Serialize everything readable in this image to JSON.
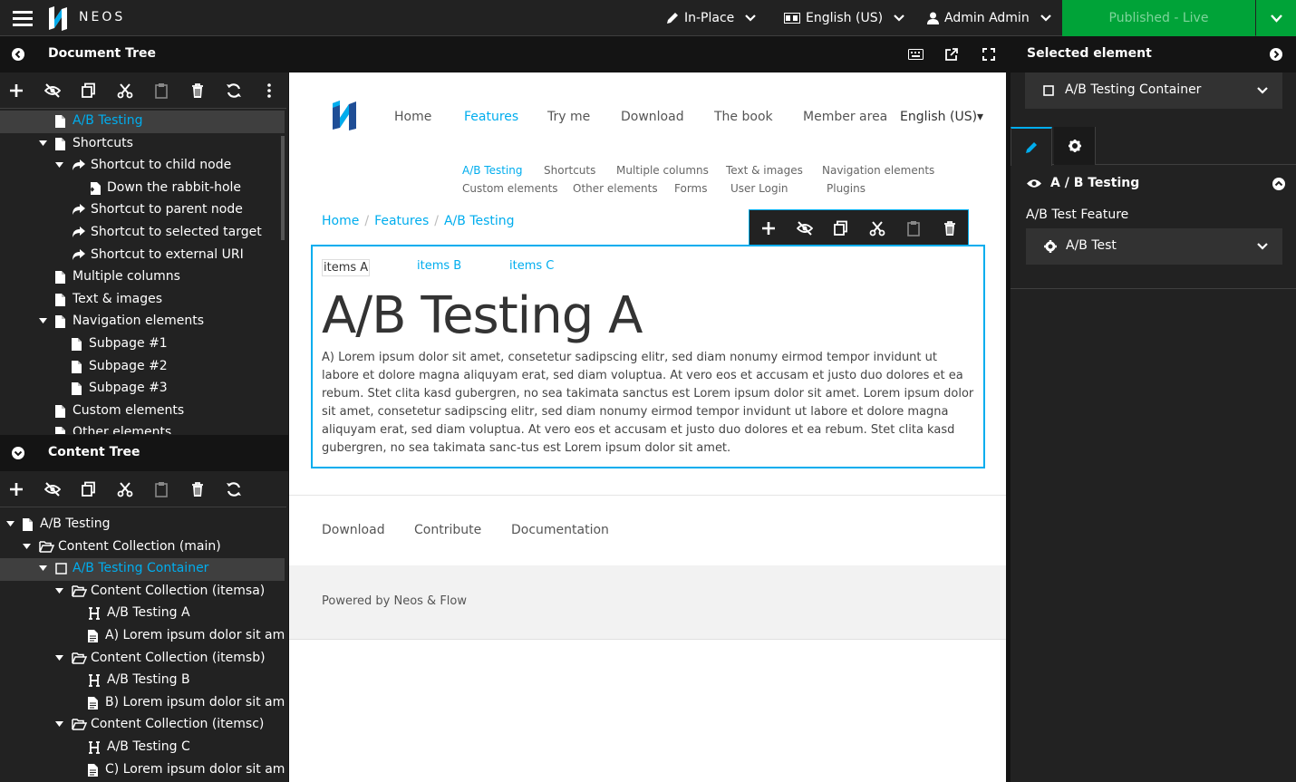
{
  "topbar": {
    "brand": "NEOS",
    "edit_mode": "In-Place",
    "language": "English (US)",
    "user": "Admin Admin",
    "publish_label": "Published - Live"
  },
  "document_tree": {
    "title": "Document Tree",
    "items": [
      {
        "label": "A/B Testing",
        "level": 2,
        "icon": "file-icon",
        "selected": true
      },
      {
        "label": "Shortcuts",
        "level": 2,
        "icon": "file-icon",
        "caret": true
      },
      {
        "label": "Shortcut to child node",
        "level": 3,
        "icon": "share-icon",
        "caret": true
      },
      {
        "label": "Down the rabbit-hole",
        "level": 4,
        "icon": "file-import-icon"
      },
      {
        "label": "Shortcut to parent node",
        "level": 3,
        "icon": "share-icon"
      },
      {
        "label": "Shortcut to selected target",
        "level": 3,
        "icon": "share-icon"
      },
      {
        "label": "Shortcut to external URI",
        "level": 3,
        "icon": "share-icon"
      },
      {
        "label": "Multiple columns",
        "level": 2,
        "icon": "file-icon"
      },
      {
        "label": "Text & images",
        "level": 2,
        "icon": "file-icon"
      },
      {
        "label": "Navigation elements",
        "level": 2,
        "icon": "file-icon",
        "caret": true
      },
      {
        "label": "Subpage #1",
        "level": 3,
        "icon": "file-icon"
      },
      {
        "label": "Subpage #2",
        "level": 3,
        "icon": "file-icon"
      },
      {
        "label": "Subpage #3",
        "level": 3,
        "icon": "file-icon"
      },
      {
        "label": "Custom elements",
        "level": 2,
        "icon": "file-icon"
      },
      {
        "label": "Other elements",
        "level": 2,
        "icon": "file-icon"
      }
    ]
  },
  "content_tree": {
    "title": "Content Tree",
    "items": [
      {
        "label": "A/B Testing",
        "level": 0,
        "icon": "file-icon",
        "caret": true
      },
      {
        "label": "Content Collection (main)",
        "level": 1,
        "icon": "folder-open-icon",
        "caret": true
      },
      {
        "label": "A/B Testing Container",
        "level": 2,
        "icon": "square-icon",
        "caret": true,
        "selected": true
      },
      {
        "label": "Content Collection (itemsa)",
        "level": 3,
        "icon": "folder-open-icon",
        "caret": true
      },
      {
        "label": "A/B Testing A",
        "level": 4,
        "icon": "heading-icon"
      },
      {
        "label": "A) Lorem ipsum dolor sit amet",
        "level": 4,
        "icon": "file-text-icon"
      },
      {
        "label": "Content Collection (itemsb)",
        "level": 3,
        "icon": "folder-open-icon",
        "caret": true
      },
      {
        "label": "A/B Testing B",
        "level": 4,
        "icon": "heading-icon"
      },
      {
        "label": "B) Lorem ipsum dolor sit amet",
        "level": 4,
        "icon": "file-text-icon"
      },
      {
        "label": "Content Collection (itemsc)",
        "level": 3,
        "icon": "folder-open-icon",
        "caret": true
      },
      {
        "label": "A/B Testing C",
        "level": 4,
        "icon": "heading-icon"
      },
      {
        "label": "C) Lorem ipsum dolor sit amet",
        "level": 4,
        "icon": "file-text-icon"
      }
    ]
  },
  "site": {
    "nav": [
      "Home",
      "Features",
      "Try me",
      "Download",
      "The book",
      "Member area"
    ],
    "nav_active": "Features",
    "language": "English (US)▾",
    "subnav_row1": [
      "A/B Testing",
      "Shortcuts",
      "Multiple columns",
      "Text & images",
      "Navigation elements"
    ],
    "subnav_row2": [
      "Custom elements",
      "Other elements",
      "Forms",
      "User Login",
      "Plugins"
    ],
    "breadcrumb": [
      "Home",
      "Features",
      "A/B Testing"
    ],
    "tabs": [
      "items A",
      "items B",
      "items C"
    ],
    "heading": "A/B Testing A",
    "paragraph": "A) Lorem ipsum dolor sit amet, consetetur sadipscing elitr, sed diam nonumy eirmod tempor invidunt ut labore et dolore magna aliquyam erat, sed diam voluptua. At vero eos et accusam et justo duo dolores et ea rebum. Stet clita kasd gubergren, no sea takimata sanctus est Lorem ipsum dolor sit amet. Lorem ipsum dolor sit amet, consetetur sadipscing elitr, sed diam nonumy eirmod tempor invidunt ut labore et dolore magna aliquyam erat, sed diam voluptua. At vero eos et accusam et justo duo dolores et ea rebum. Stet clita kasd gubergren, no sea takimata sanc-tus est Lorem ipsum dolor sit amet.",
    "footer_links": [
      "Download",
      "Contribute",
      "Documentation"
    ],
    "powered_by": "Powered by Neos & Flow"
  },
  "inspector": {
    "title": "Selected element",
    "selected": "A/B Testing Container",
    "group": "A / B Testing",
    "field_label": "A/B Test Feature",
    "field_value": "A/B Test"
  },
  "colors": {
    "accent": "#00adee",
    "publish": "#00a338",
    "panel": "#222222",
    "dark": "#141414"
  }
}
